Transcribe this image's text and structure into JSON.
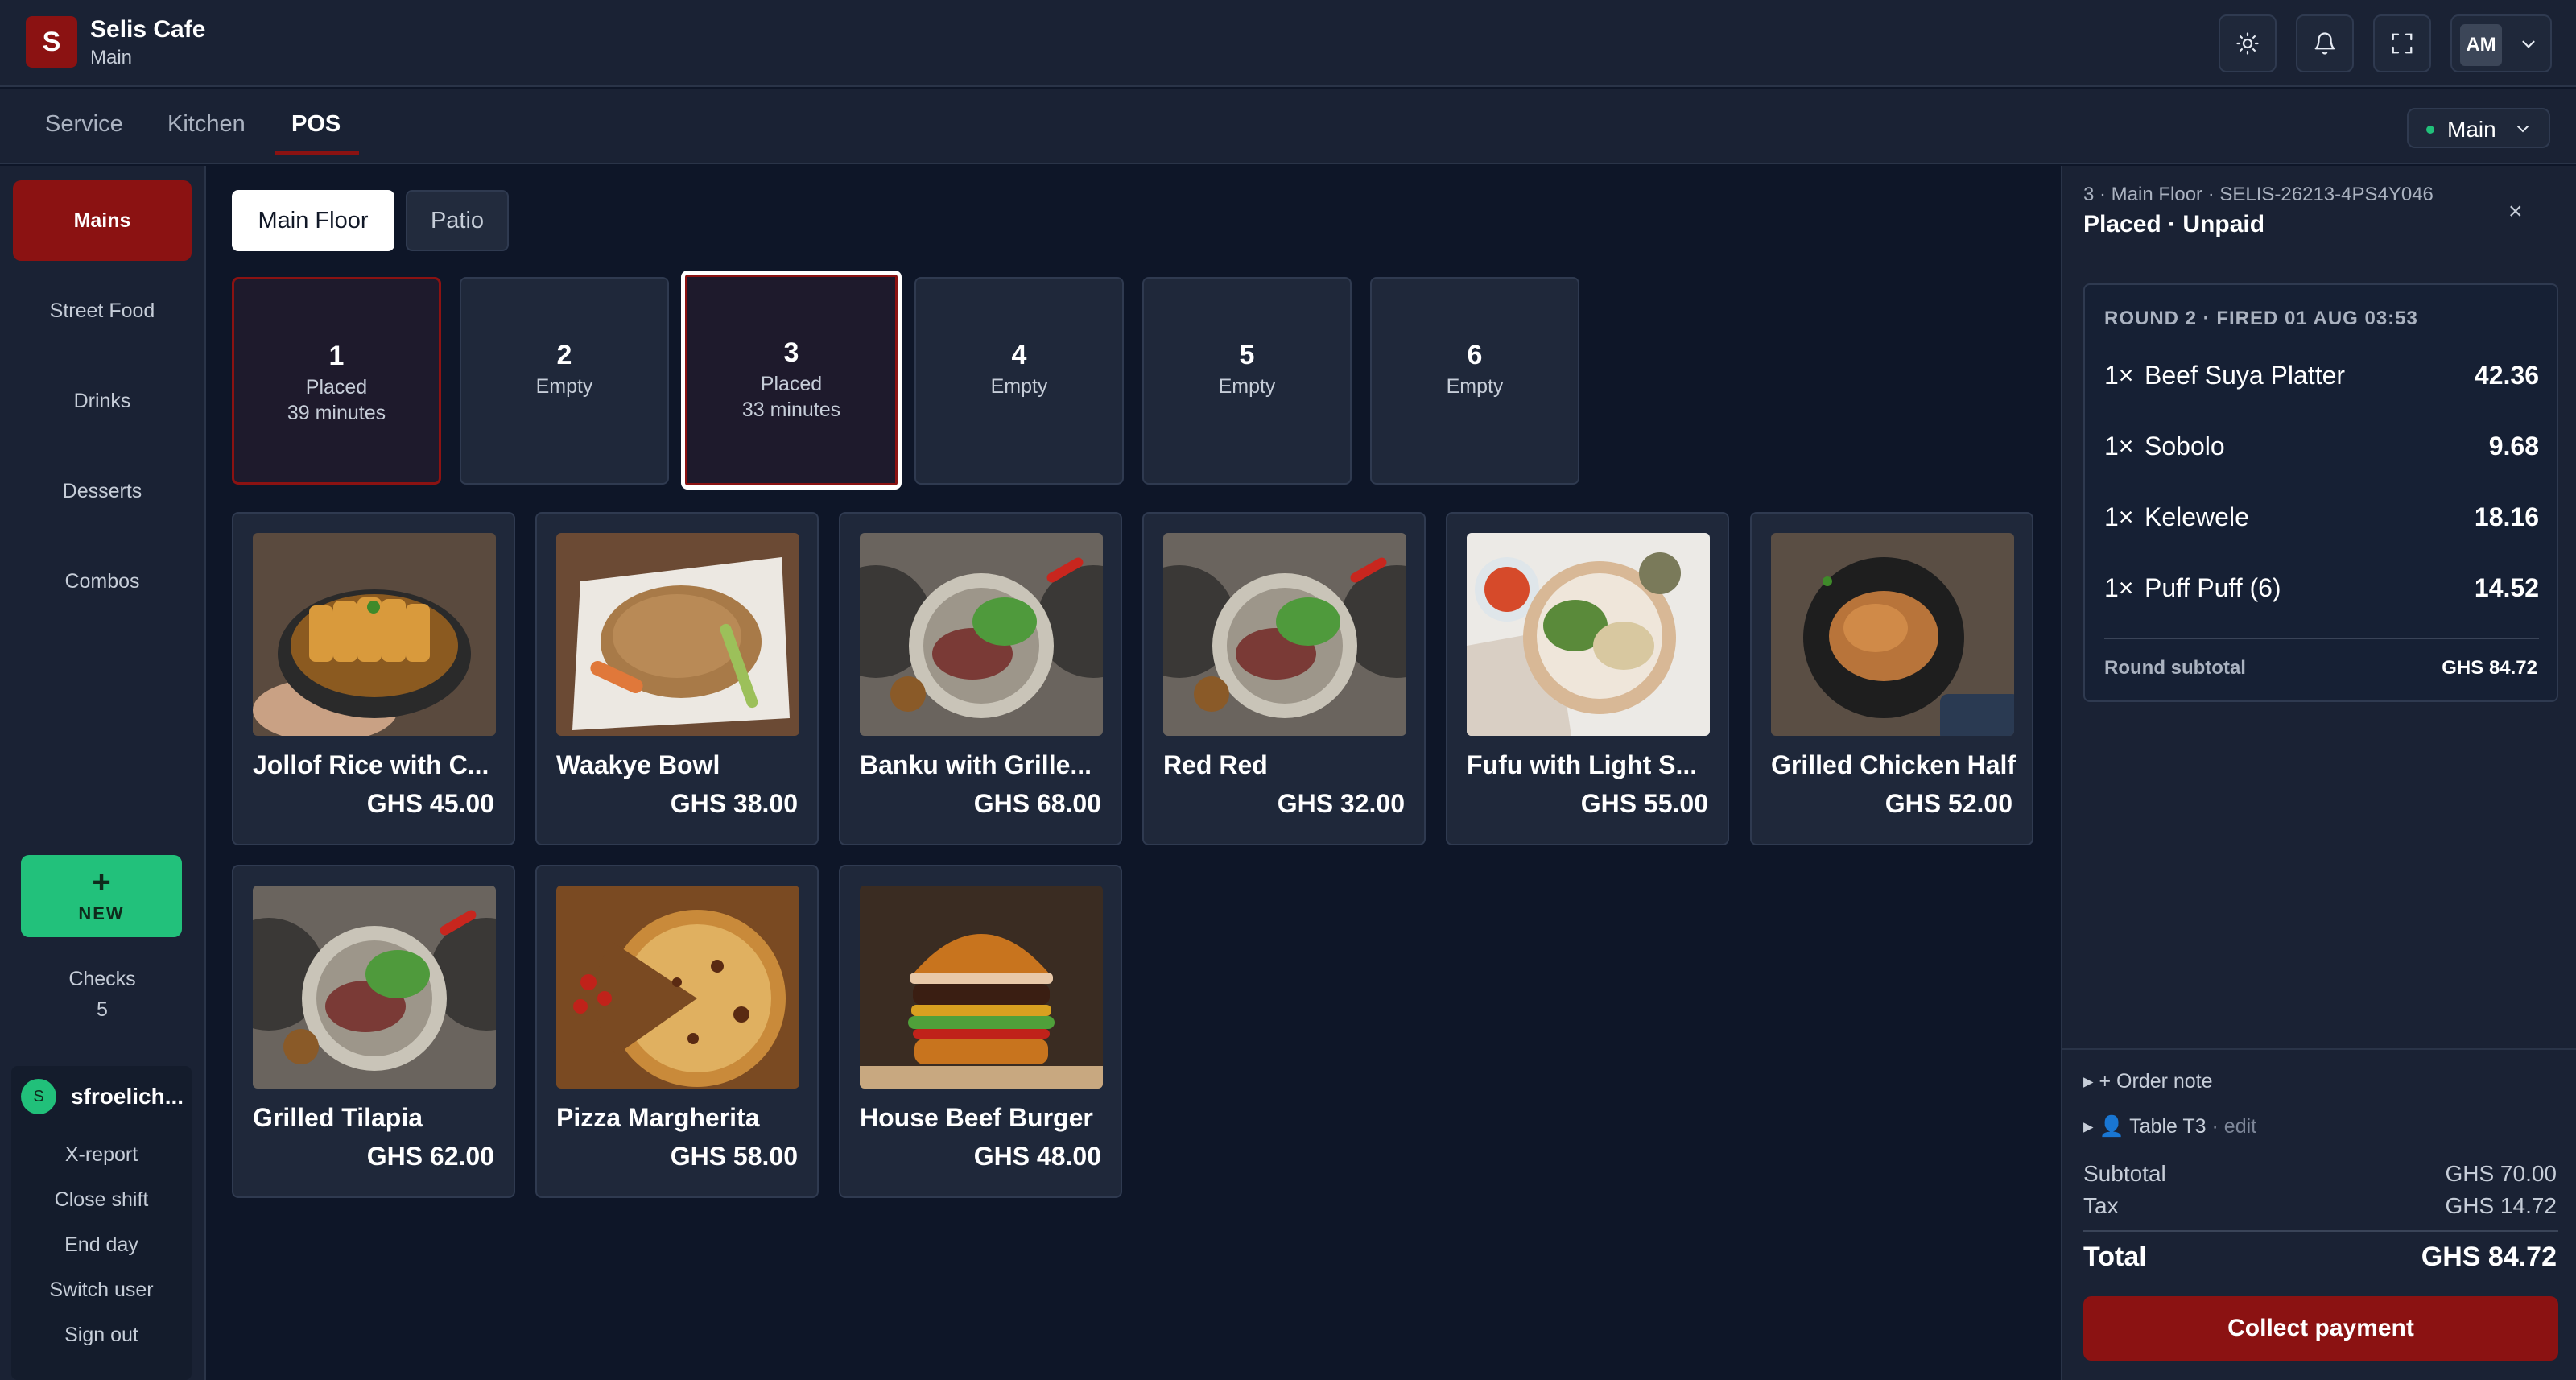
{
  "app": {
    "logo_letter": "S",
    "name": "Selis Cafe",
    "location": "Main"
  },
  "header": {
    "icons": [
      "sun-icon",
      "bell-icon",
      "fullscreen-icon"
    ],
    "user_initials": "AM"
  },
  "tabs": [
    {
      "label": "Service",
      "active": false
    },
    {
      "label": "Kitchen",
      "active": false
    },
    {
      "label": "POS",
      "active": true
    }
  ],
  "location_select": {
    "label": "Main",
    "status_color": "#21c07a"
  },
  "categories": [
    {
      "label": "Mains",
      "active": true
    },
    {
      "label": "Street Food",
      "active": false
    },
    {
      "label": "Drinks",
      "active": false
    },
    {
      "label": "Desserts",
      "active": false
    },
    {
      "label": "Combos",
      "active": false
    }
  ],
  "sidebar": {
    "new_plus": "+",
    "new_label": "NEW",
    "checks_label": "Checks",
    "checks_count": "5",
    "user_initial": "S",
    "user_name": "sfroelich...",
    "actions": [
      "X-report",
      "Close shift",
      "End day",
      "Switch user",
      "Sign out"
    ]
  },
  "floors": [
    {
      "label": "Main Floor",
      "active": true
    },
    {
      "label": "Patio",
      "active": false
    }
  ],
  "tables": [
    {
      "number": "1",
      "status": "Placed",
      "time": "39 minutes",
      "state": "placed"
    },
    {
      "number": "2",
      "status": "Empty",
      "time": "",
      "state": "empty"
    },
    {
      "number": "3",
      "status": "Placed",
      "time": "33 minutes",
      "state": "selected"
    },
    {
      "number": "4",
      "status": "Empty",
      "time": "",
      "state": "empty"
    },
    {
      "number": "5",
      "status": "Empty",
      "time": "",
      "state": "empty"
    },
    {
      "number": "6",
      "status": "Empty",
      "time": "",
      "state": "empty"
    }
  ],
  "products": [
    {
      "name": "Jollof Rice with C...",
      "price": "GHS 45.00"
    },
    {
      "name": "Waakye Bowl",
      "price": "GHS 38.00"
    },
    {
      "name": "Banku with Grille...",
      "price": "GHS 68.00"
    },
    {
      "name": "Red Red",
      "price": "GHS 32.00"
    },
    {
      "name": "Fufu with Light S...",
      "price": "GHS 55.00"
    },
    {
      "name": "Grilled Chicken Half",
      "price": "GHS 52.00"
    },
    {
      "name": "Grilled Tilapia",
      "price": "GHS 62.00"
    },
    {
      "name": "Pizza Margherita",
      "price": "GHS 58.00"
    },
    {
      "name": "House Beef Burger",
      "price": "GHS 48.00"
    }
  ],
  "order": {
    "reference": "3 · Main Floor · SELIS-26213-4PS4Y046",
    "status": "Placed · Unpaid",
    "close_glyph": "×",
    "round_header": "ROUND 2 · FIRED 01 AUG 03:53",
    "items": [
      {
        "qty": "1×",
        "name": "Beef Suya Platter",
        "price": "42.36"
      },
      {
        "qty": "1×",
        "name": "Sobolo",
        "price": "9.68"
      },
      {
        "qty": "1×",
        "name": "Kelewele",
        "price": "18.16"
      },
      {
        "qty": "1×",
        "name": "Puff Puff (6)",
        "price": "14.52"
      }
    ],
    "round_subtotal_label": "Round subtotal",
    "round_subtotal_value": "GHS 84.72",
    "order_note": "▸ + Order note",
    "table_label": "Table T3",
    "table_edit": "· edit",
    "subtotal_label": "Subtotal",
    "subtotal_value": "GHS 70.00",
    "tax_label": "Tax",
    "tax_value": "GHS 14.72",
    "total_label": "Total",
    "total_value": "GHS 84.72",
    "pay_label": "Collect payment"
  },
  "colors": {
    "accent": "#8b1212",
    "success": "#22c17b",
    "background": "#0e1628",
    "panel": "#1a2234"
  }
}
